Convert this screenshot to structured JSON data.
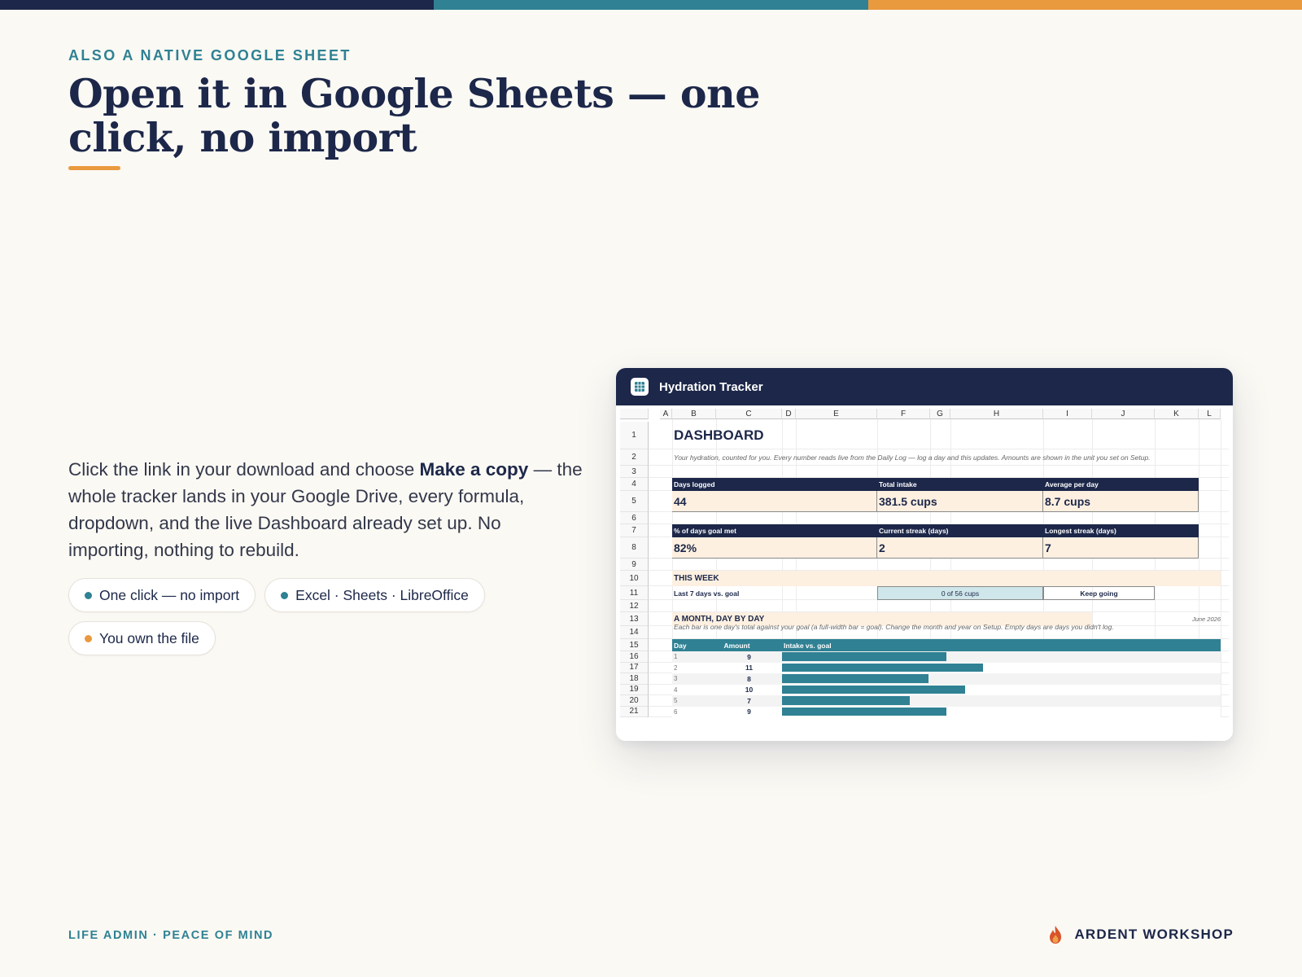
{
  "colors": {
    "navy": "#1c2749",
    "teal": "#2f8193",
    "orange": "#e9993e",
    "background": "#fbf9f4",
    "peach": "#fdf0e1"
  },
  "eyebrow": "ALSO A NATIVE GOOGLE SHEET",
  "headline": "Open it in Google Sheets — one click, no import",
  "body": {
    "before": "Click the link in your download and choose ",
    "bold": "Make a copy",
    "after": " — the whole tracker lands in your Google Drive, every formula, dropdown, and the live Dashboard already set up. No importing, nothing to rebuild."
  },
  "pills": [
    {
      "label": "One click — no import",
      "dot_color": "#2f8193"
    },
    {
      "label": "Excel · Sheets · LibreOffice",
      "dot_color": "#2f8193"
    },
    {
      "label": "You own the file",
      "dot_color": "#e9993e"
    }
  ],
  "footer": {
    "left": "LIFE ADMIN · PEACE OF MIND",
    "brand": "ARDENT WORKSHOP",
    "brand_icon": "flame-icon"
  },
  "window": {
    "title": "Hydration Tracker",
    "icon": "sheet-grid-icon",
    "columns": [
      "A",
      "B",
      "C",
      "D",
      "E",
      "F",
      "G",
      "H",
      "I",
      "J",
      "K",
      "L"
    ],
    "rows": [
      "1",
      "2",
      "3",
      "4",
      "5",
      "6",
      "7",
      "8",
      "9",
      "10",
      "11",
      "12",
      "13",
      "14",
      "15",
      "16",
      "17",
      "18",
      "19",
      "20",
      "21"
    ],
    "dashboard_title": "DASHBOARD",
    "subtitle": "Your hydration, counted for you. Every number reads live from the Daily Log — log a day and this updates. Amounts are shown in the unit you set on Setup.",
    "kpis_row1": [
      {
        "label": "Days logged",
        "value": "44"
      },
      {
        "label": "Total intake",
        "value": "381.5 cups"
      },
      {
        "label": "Average per day",
        "value": "8.7 cups"
      }
    ],
    "kpis_row2": [
      {
        "label": "% of days goal met",
        "value": "82%"
      },
      {
        "label": "Current streak (days)",
        "value": "2"
      },
      {
        "label": "Longest streak (days)",
        "value": "7"
      }
    ],
    "this_week": {
      "label": "THIS WEEK",
      "sub_label": "Last 7 days vs. goal",
      "progress_text": "0 of 56 cups",
      "status": "Keep going"
    },
    "month": {
      "label": "A MONTH, DAY BY DAY",
      "date": "June 2026",
      "note": "Each bar is one day's total against your goal (a full-width bar = goal). Change the month and year on Setup. Empty days are days you didn't log."
    },
    "table": {
      "headers": [
        "Day",
        "Amount",
        "Intake vs. goal"
      ],
      "rows": [
        {
          "day": "1",
          "amount": "9"
        },
        {
          "day": "2",
          "amount": "11"
        },
        {
          "day": "3",
          "amount": "8"
        },
        {
          "day": "4",
          "amount": "10"
        },
        {
          "day": "5",
          "amount": "7"
        },
        {
          "day": "6",
          "amount": "9"
        }
      ]
    }
  }
}
